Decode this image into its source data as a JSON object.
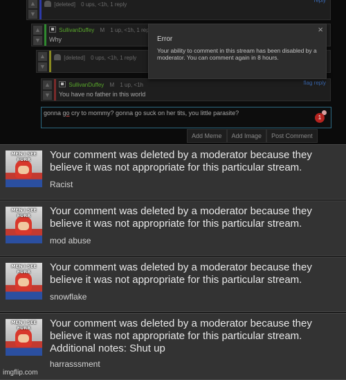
{
  "thread": {
    "comments": [
      {
        "user": "[deleted]",
        "stats": "0 ups, <1h, 1 reply",
        "body": "",
        "link": "reply",
        "bar": "#2d3aa8"
      },
      {
        "user": "SullivanDuffey",
        "badge": "M",
        "stats": "1 up, <1h, 1 reply",
        "body": "Why",
        "link": "reply",
        "bar": "#2f8a2f"
      },
      {
        "user": "[deleted]",
        "stats": "0 ups, <1h, 1 reply",
        "body": "",
        "link": "reply",
        "bar": "#8a8a20"
      },
      {
        "user": "SullivanDuffey",
        "badge": "M",
        "stats": "1 up, <1h",
        "body": "You have no father in this world",
        "link": "flag reply",
        "bar": "#7a2a2a"
      }
    ],
    "up_arrow": "up-arrow-icon",
    "down_arrow": "down-arrow-icon"
  },
  "error_dialog": {
    "title": "Error",
    "message": "Your ability to comment in this stream has been disabled by a moderator. You can comment again in 8 hours.",
    "close": "×"
  },
  "composer": {
    "pre": "gonna ",
    "underlined": "go",
    "post": " cry to mommy? gonna go suck on her tits, you little parasite?",
    "badge": "1",
    "buttons": [
      "Add Meme",
      "Add Image",
      "Post Comment"
    ]
  },
  "notifications": [
    {
      "message": "Your comment was deleted by a moderator because they believe it was not appropriate for this particular stream.",
      "reason": "Racist",
      "thumb_caption": "MEN I SEE FURR"
    },
    {
      "message": "Your comment was deleted by a moderator because they believe it was not appropriate for this particular stream.",
      "reason": "mod abuse",
      "thumb_caption": "MEN I SEE FURR"
    },
    {
      "message": "Your comment was deleted by a moderator because they believe it was not appropriate for this particular stream.",
      "reason": "snowflake",
      "thumb_caption": "MEN I SEE FURR"
    },
    {
      "message": "Your comment was deleted by a moderator because they believe it was not appropriate for this particular stream. Additional notes: Shut up",
      "reason": "harrasssment",
      "thumb_caption": "MEN I SEE FURR"
    }
  ],
  "watermark": "imgflip.com"
}
